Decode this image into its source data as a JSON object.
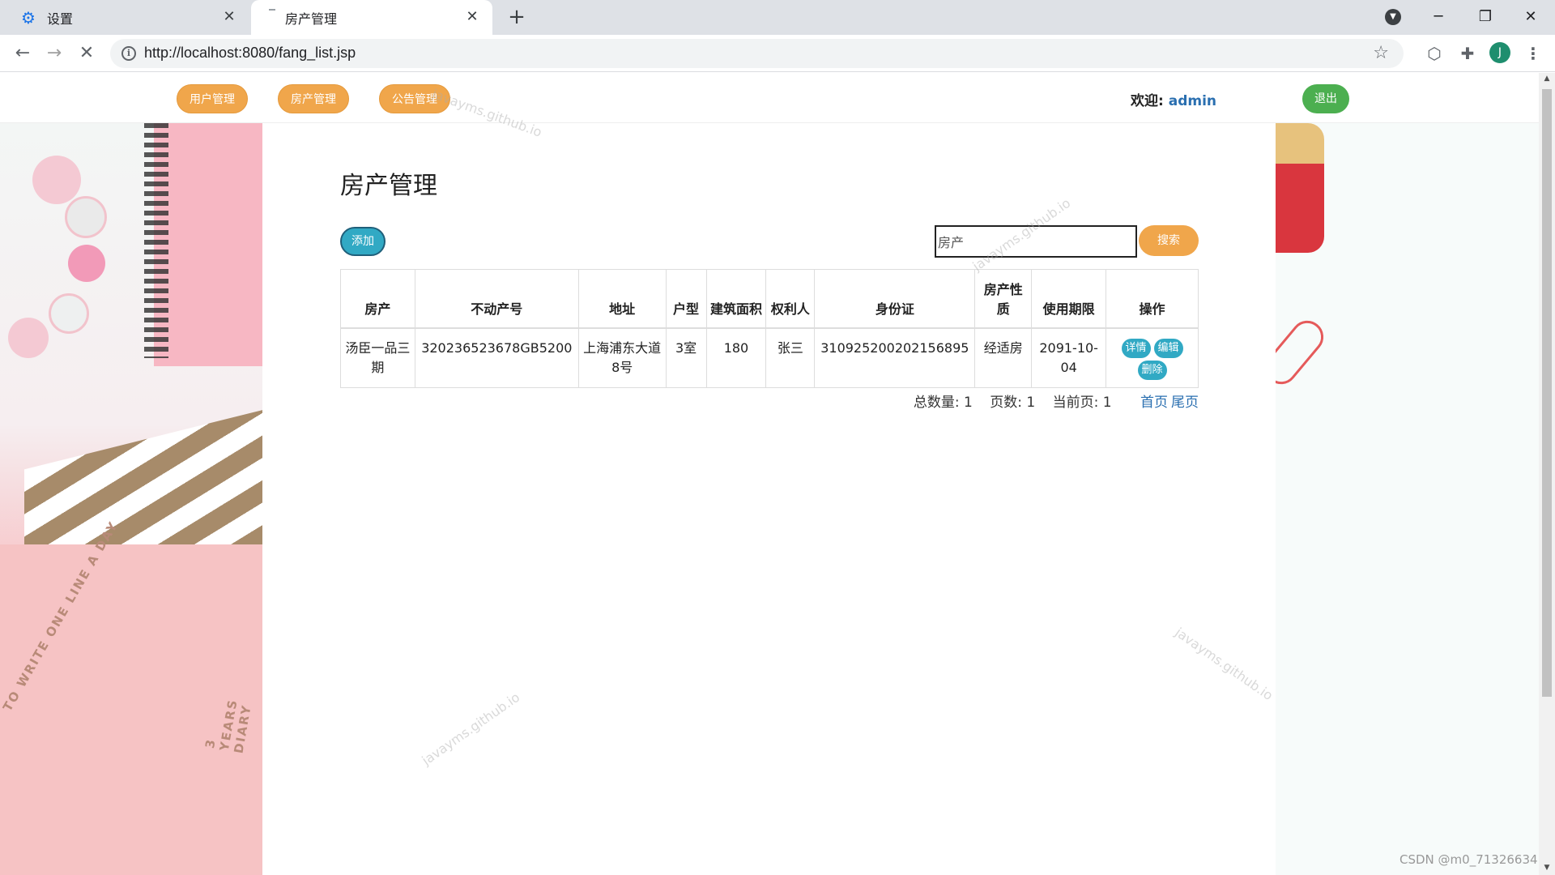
{
  "browser": {
    "tabs": [
      {
        "label": "设置",
        "active": false
      },
      {
        "label": "房产管理",
        "active": true
      }
    ],
    "url": "http://localhost:8080/fang_list.jsp",
    "avatar_letter": "J"
  },
  "header": {
    "menu": [
      {
        "label": "用户管理"
      },
      {
        "label": "房产管理"
      },
      {
        "label": "公告管理"
      }
    ],
    "welcome_label": "欢迎:",
    "username": "admin",
    "logout_label": "退出"
  },
  "main": {
    "title": "房产管理",
    "add_label": "添加",
    "search": {
      "value": "房产",
      "button_label": "搜索"
    },
    "table": {
      "columns": [
        "房产",
        "不动产号",
        "地址",
        "户型",
        "建筑面积",
        "权利人",
        "身份证",
        "房产性质",
        "使用期限",
        "操作"
      ],
      "rows": [
        {
          "cells": [
            "汤臣一品三期",
            "320236523678GB5200",
            "上海浦东大道8号",
            "3室",
            "180",
            "张三",
            "310925200202156895",
            "经适房",
            "2091-10-04"
          ],
          "actions": [
            "详情",
            "编辑",
            "删除"
          ]
        }
      ]
    },
    "pager": {
      "total_label": "总数量:",
      "total": "1",
      "pages_label": "页数:",
      "pages": "1",
      "current_label": "当前页:",
      "current": "1",
      "first_label": "首页",
      "last_label": "尾页"
    }
  },
  "decor": {
    "watermark": "javayms.github.io",
    "book_text_1": "TO WRITE ONE LINE A DAY",
    "book_text_2": "3 YEARS DIARY"
  },
  "footer_credit": "CSDN @m0_71326634",
  "colors": {
    "orange": "#f0a64b",
    "teal": "#31a9c4",
    "green": "#4caf50",
    "link": "#2a6fb0"
  }
}
